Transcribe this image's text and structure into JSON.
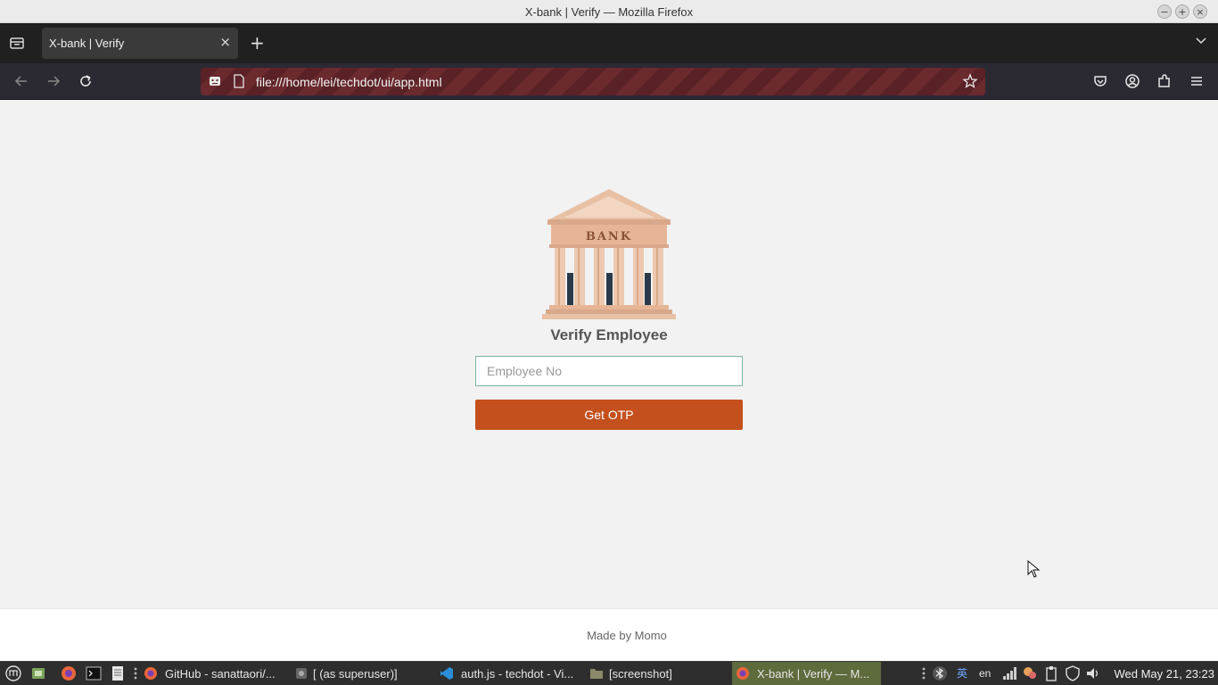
{
  "window": {
    "title": "X-bank | Verify — Mozilla Firefox"
  },
  "browser": {
    "tab_title": "X-bank | Verify",
    "tab_close": "×",
    "new_tab": "+",
    "url": "file:///home/lei/techdot/ui/app.html"
  },
  "page": {
    "logo_text": "BANK",
    "heading": "Verify Employee",
    "input_placeholder": "Employee No",
    "button_label": "Get OTP",
    "footer": "Made by Momo"
  },
  "taskbar": {
    "items": [
      {
        "label": "GitHub - sanattaori/...",
        "icon": "firefox-icon"
      },
      {
        "label": "[ (as superuser)]",
        "icon": "app-icon"
      },
      {
        "label": "auth.js - techdot - Vi...",
        "icon": "vscode-icon"
      },
      {
        "label": "[screenshot]",
        "icon": "folder-icon"
      },
      {
        "label": "X-bank | Verify — M...",
        "icon": "firefox-icon",
        "active": true
      }
    ],
    "ime": "英",
    "lang": "en",
    "clock": "Wed May 21, 23:23"
  },
  "colors": {
    "accent_button": "#c4501d",
    "input_border": "#7cb5a4",
    "url_bar": "#6a2a2e"
  }
}
